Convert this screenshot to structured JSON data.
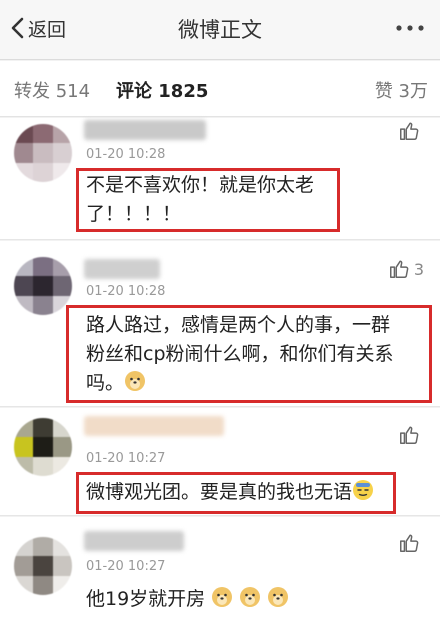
{
  "nav": {
    "back_label": "返回",
    "title": "微博正文"
  },
  "tabs": {
    "repost": "转发 514",
    "comment": "评论 1825",
    "like": "赞 3万"
  },
  "comments": [
    {
      "time": "01-20 10:28",
      "text": "不是不喜欢你！就是你太老",
      "text2": "了！！！！",
      "likes": ""
    },
    {
      "time": "01-20 10:28",
      "text": "路人路过，感情是两个人的事，一群",
      "text2": "粉丝和cp粉闹什么啊，和你们有关系",
      "text3": "吗。",
      "likes": "3"
    },
    {
      "time": "01-20 10:27",
      "text": "微博观光团。要是真的我也无语",
      "likes": ""
    },
    {
      "time": "01-20 10:27",
      "text": "他19岁就开房",
      "likes": ""
    }
  ],
  "icons": {
    "back": "chevron-left-icon",
    "more": "more-dots-icon",
    "like": "thumbs-up-icon",
    "emoji_doge": "doge-emoji-icon",
    "emoji_sweat": "sweat-emoji-icon"
  },
  "colors": {
    "highlight_border": "#d72b2b",
    "time": "#999999",
    "bg": "#f2f2f2"
  }
}
